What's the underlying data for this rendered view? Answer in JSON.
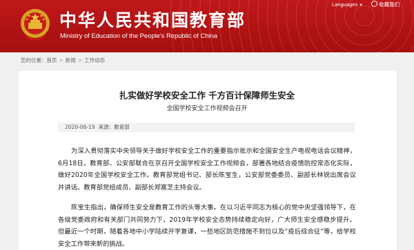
{
  "header": {
    "title_cn": "中华人民共和国教育部",
    "title_en": "Ministry of Education of the People's Republic of China",
    "languages": "Languages",
    "favorites": "收藏我们",
    "brand_color": "#b1120f"
  },
  "breadcrumb": {
    "prefix": "您的位置：",
    "items": [
      "首页",
      "新闻",
      "工作动态"
    ]
  },
  "article": {
    "title": "扎实做好学校安全工作 千方百计保障师生安全",
    "subtitle": "全国学校安全工作视频会召开",
    "date": "2020-06-19",
    "source": "来源：教育部",
    "paragraphs": [
      "为深入贯彻落实中央领导关于做好学校安全工作的重要指示批示和全国安全生产电视电话会议精神，6月18日，教育部、公安部联合在京召开全国学校安全工作视频会，部署各地结合疫情防控常态化实际，做好2020年全国学校安全工作。教育部党组书记、部长陈宝生，公安部党委委员、副部长林锐出席会议并讲话。教育部党组成员、副部长郑富芝主持会议。",
      "陈宝生指出，确保师生安全是教育工作的头等大事。在以习近平同志为核心的党中央坚强领导下，在各级党委政府和有关部门共同努力下，2019年学校安全态势持续稳定向好，广大师生安全感稳步提升。但最近一个时期，随着各地中小学陆续开学复课，一些地区防范措施不到位以及“疫后综合征”等，给学校安全工作带来新的挑战。"
    ]
  }
}
